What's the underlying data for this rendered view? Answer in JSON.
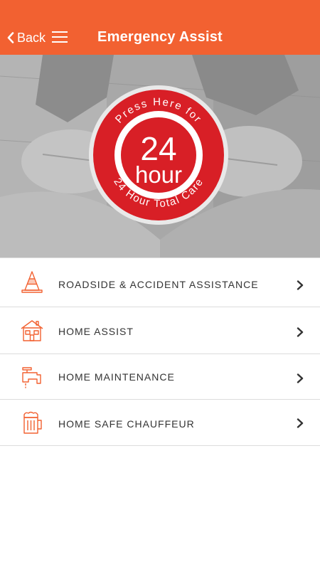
{
  "header": {
    "back_label": "Back",
    "title": "Emergency Assist",
    "back_icon": "chevron-left-icon",
    "menu_icon": "hamburger-menu-icon",
    "background_color": "#f26131"
  },
  "hero": {
    "badge": {
      "top_text": "Press Here for",
      "number": "24",
      "word": "hour",
      "bottom_text": "24 Hour Total Care",
      "color": "#d81f26"
    }
  },
  "services": [
    {
      "label": "ROADSIDE & ACCIDENT ASSISTANCE",
      "icon": "traffic-cone-icon"
    },
    {
      "label": "HOME ASSIST",
      "icon": "house-icon"
    },
    {
      "label": "HOME MAINTENANCE",
      "icon": "water-tap-icon"
    },
    {
      "label": "HOME SAFE CHAUFFEUR",
      "icon": "beer-mug-icon"
    }
  ],
  "colors": {
    "accent": "#f26131",
    "icon": "#f26131",
    "text": "#333333",
    "divider": "#dcdcdc"
  }
}
